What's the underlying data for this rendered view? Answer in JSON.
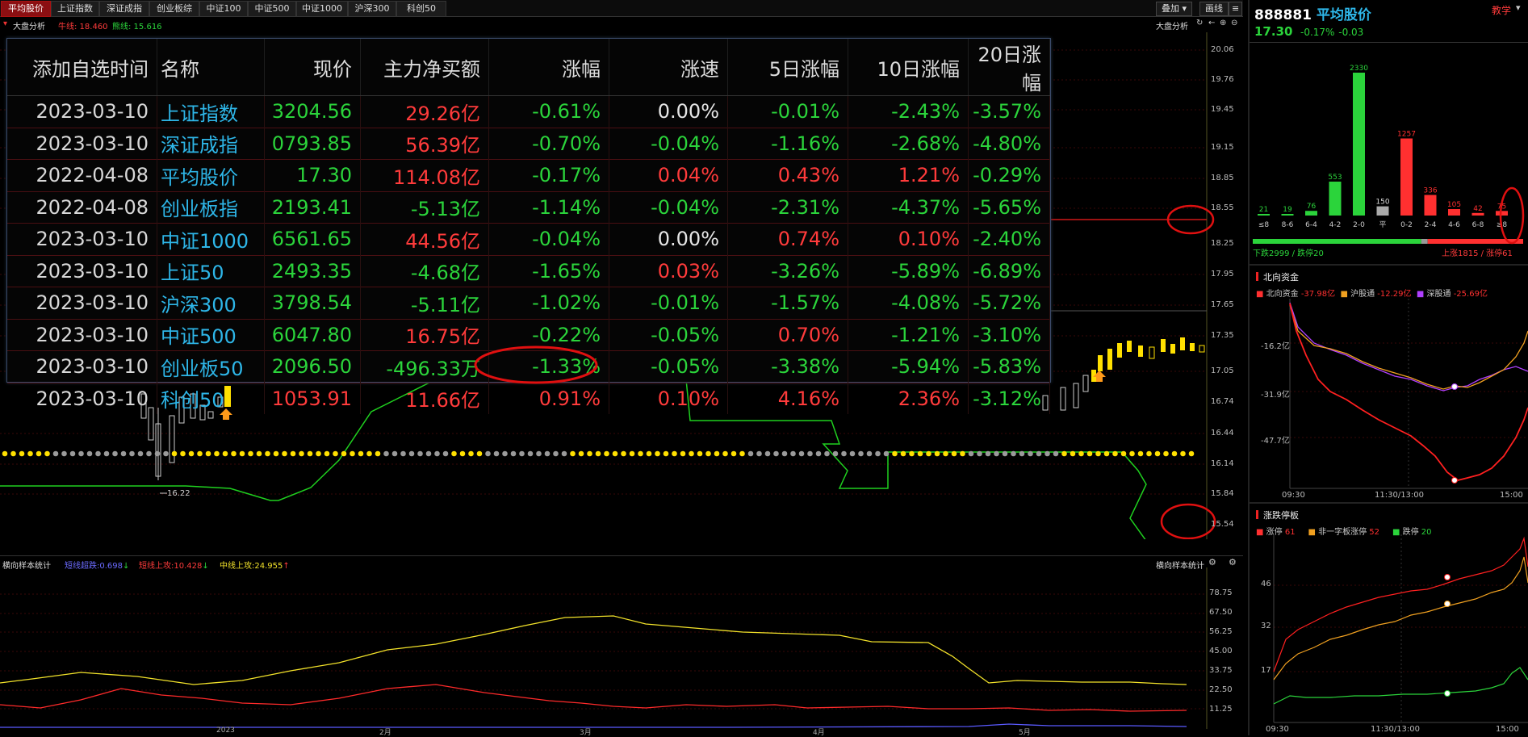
{
  "tabs": [
    "平均股价",
    "上证指数",
    "深证成指",
    "创业板综",
    "中证100",
    "中证500",
    "中证1000",
    "沪深300",
    "科创50"
  ],
  "toolbar": {
    "overlay": "叠加",
    "draw": "画线"
  },
  "info": {
    "title": "大盘分析",
    "niu": "牛线: 18.460",
    "xiong": "熊线: 15.616",
    "right_title": "大盘分析"
  },
  "price_axis": [
    "20.06",
    "19.76",
    "19.45",
    "19.15",
    "18.85",
    "18.55",
    "18.25",
    "17.95",
    "17.65",
    "17.35",
    "17.05",
    "16.74",
    "16.44",
    "16.14",
    "15.84",
    "15.54"
  ],
  "low_label": "16.22",
  "overlay_table": {
    "headers": [
      "添加自选时间",
      "名称",
      "现价",
      "主力净买额",
      "涨幅",
      "涨速",
      "5日涨幅",
      "10日涨幅",
      "20日涨幅"
    ],
    "rows": [
      {
        "date": "2023-03-10",
        "name": "上证指数",
        "price": "3204.56",
        "flow": "29.26亿",
        "chg": "-0.61%",
        "speed": "0.00%",
        "d5": "-0.01%",
        "d10": "-2.43%",
        "d20": "-3.57%",
        "c": [
          "dn",
          "up",
          "dn",
          "fl",
          "dn",
          "dn",
          "dn"
        ]
      },
      {
        "date": "2023-03-10",
        "name": "深证成指",
        "price": "0793.85",
        "flow": "56.39亿",
        "chg": "-0.70%",
        "speed": "-0.04%",
        "d5": "-1.16%",
        "d10": "-2.68%",
        "d20": "-4.80%",
        "c": [
          "dn",
          "up",
          "dn",
          "dn",
          "dn",
          "dn",
          "dn"
        ]
      },
      {
        "date": "2022-04-08",
        "name": "平均股价",
        "price": "17.30",
        "flow": "114.08亿",
        "chg": "-0.17%",
        "speed": "0.04%",
        "d5": "0.43%",
        "d10": "1.21%",
        "d20": "-0.29%",
        "c": [
          "dn",
          "up",
          "dn",
          "up",
          "up",
          "up",
          "dn"
        ]
      },
      {
        "date": "2022-04-08",
        "name": "创业板指",
        "price": "2193.41",
        "flow": "-5.13亿",
        "chg": "-1.14%",
        "speed": "-0.04%",
        "d5": "-2.31%",
        "d10": "-4.37%",
        "d20": "-5.65%",
        "c": [
          "dn",
          "dn",
          "dn",
          "dn",
          "dn",
          "dn",
          "dn"
        ]
      },
      {
        "date": "2023-03-10",
        "name": "中证1000",
        "price": "6561.65",
        "flow": "44.56亿",
        "chg": "-0.04%",
        "speed": "0.00%",
        "d5": "0.74%",
        "d10": "0.10%",
        "d20": "-2.40%",
        "c": [
          "dn",
          "up",
          "dn",
          "fl",
          "up",
          "up",
          "dn"
        ]
      },
      {
        "date": "2023-03-10",
        "name": "上证50",
        "price": "2493.35",
        "flow": "-4.68亿",
        "chg": "-1.65%",
        "speed": "0.03%",
        "d5": "-3.26%",
        "d10": "-5.89%",
        "d20": "-6.89%",
        "c": [
          "dn",
          "dn",
          "dn",
          "up",
          "dn",
          "dn",
          "dn"
        ]
      },
      {
        "date": "2023-03-10",
        "name": "沪深300",
        "price": "3798.54",
        "flow": "-5.11亿",
        "chg": "-1.02%",
        "speed": "-0.01%",
        "d5": "-1.57%",
        "d10": "-4.08%",
        "d20": "-5.72%",
        "c": [
          "dn",
          "dn",
          "dn",
          "dn",
          "dn",
          "dn",
          "dn"
        ]
      },
      {
        "date": "2023-03-10",
        "name": "中证500",
        "price": "6047.80",
        "flow": "16.75亿",
        "chg": "-0.22%",
        "speed": "-0.05%",
        "d5": "0.70%",
        "d10": "-1.21%",
        "d20": "-3.10%",
        "c": [
          "dn",
          "up",
          "dn",
          "dn",
          "up",
          "dn",
          "dn"
        ]
      },
      {
        "date": "2023-03-10",
        "name": "创业板50",
        "price": "2096.50",
        "flow": "-496.33万",
        "chg": "-1.33%",
        "speed": "-0.05%",
        "d5": "-3.38%",
        "d10": "-5.94%",
        "d20": "-5.83%",
        "c": [
          "dn",
          "dn",
          "dn",
          "dn",
          "dn",
          "dn",
          "dn"
        ]
      },
      {
        "date": "2023-03-10",
        "name": "科创50",
        "price": "1053.91",
        "flow": "11.66亿",
        "chg": "0.91%",
        "speed": "0.10%",
        "d5": "4.16%",
        "d10": "2.36%",
        "d20": "-3.12%",
        "c": [
          "up",
          "up",
          "up",
          "up",
          "up",
          "up",
          "dn"
        ]
      }
    ]
  },
  "sub_chart": {
    "title": "横向样本统计",
    "right_title": "横向样本统计",
    "legend": [
      {
        "label": "短线超跌:0.698",
        "arrow": "↓",
        "color": "#6b6bff"
      },
      {
        "label": "短线上攻:10.428",
        "arrow": "↓",
        "color": "#ff3b3b"
      },
      {
        "label": "中线上攻:24.955",
        "arrow": "↑",
        "color": "#f2e22a"
      }
    ],
    "axis": [
      "78.75",
      "67.50",
      "56.25",
      "45.00",
      "33.75",
      "22.50",
      "11.25"
    ],
    "dates": [
      "2023",
      "2月",
      "3月",
      "4月",
      "5月"
    ]
  },
  "quote": {
    "code": "888881",
    "name": "平均股价",
    "price": "17.30",
    "chg_pct": "-0.17%",
    "chg": "-0.03",
    "teach": "教学"
  },
  "distribution": {
    "categories": [
      "≤8",
      "8-6",
      "6-4",
      "4-2",
      "2-0",
      "平",
      "0-2",
      "2-4",
      "4-6",
      "6-8",
      "≥8"
    ],
    "values": [
      21,
      19,
      76,
      553,
      2330,
      150,
      1257,
      336,
      105,
      42,
      75
    ],
    "down_label": "下跌2999 / 跌停20",
    "up_label": "上涨1815 / 涨停61"
  },
  "north": {
    "title": "北向资金",
    "legend": [
      {
        "label": "北向资金",
        "value": "-37.98亿",
        "color": "#ff3030"
      },
      {
        "label": "沪股通",
        "value": "-12.29亿",
        "color": "#f0a020"
      },
      {
        "label": "深股通",
        "value": "-25.69亿",
        "color": "#b040ff"
      }
    ],
    "axis": [
      "-16.2亿",
      "-31.9亿",
      "-47.7亿"
    ],
    "times": [
      "09:30",
      "11:30/13:00",
      "15:00"
    ]
  },
  "limits": {
    "title": "涨跌停板",
    "legend": [
      {
        "label": "涨停",
        "value": "61",
        "color": "#ff3030"
      },
      {
        "label": "非一字板涨停",
        "value": "52",
        "color": "#f0a020"
      },
      {
        "label": "跌停",
        "value": "20",
        "color": "#2bd43b"
      }
    ],
    "axis": [
      "46",
      "32",
      "17"
    ],
    "times": [
      "09:30",
      "11:30/13:00",
      "15:00"
    ]
  }
}
